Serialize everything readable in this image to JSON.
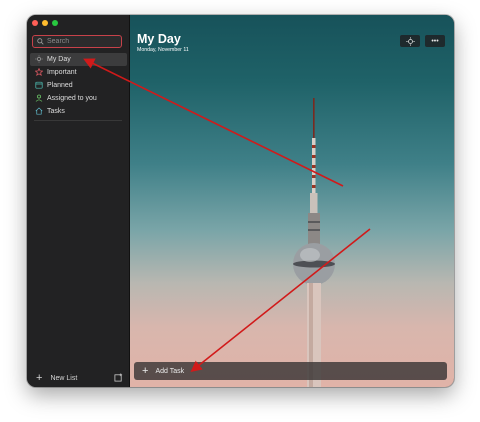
{
  "colors": {
    "accent": "#c7424a",
    "annotation": "#d11a1a",
    "sidebar_bg": "#222223"
  },
  "window": {
    "traffic_lights": [
      "close-icon",
      "minimize-icon",
      "zoom-icon"
    ]
  },
  "sidebar": {
    "search": {
      "placeholder": "Search",
      "icon": "search-icon"
    },
    "items": [
      {
        "label": "My Day",
        "icon": "sun-icon",
        "active": true
      },
      {
        "label": "Important",
        "icon": "star-icon",
        "active": false
      },
      {
        "label": "Planned",
        "icon": "calendar-icon",
        "active": false
      },
      {
        "label": "Assigned to you",
        "icon": "person-icon",
        "active": false
      },
      {
        "label": "Tasks",
        "icon": "home-icon",
        "active": false
      }
    ],
    "new_list_label": "New List",
    "new_group_icon": "new-group-icon"
  },
  "main": {
    "title": "My Day",
    "date": "Monday, November 11",
    "toolbar": {
      "suggestions_icon": "lightbulb-icon",
      "more_label": "•••"
    },
    "add_task_label": "Add Task"
  }
}
